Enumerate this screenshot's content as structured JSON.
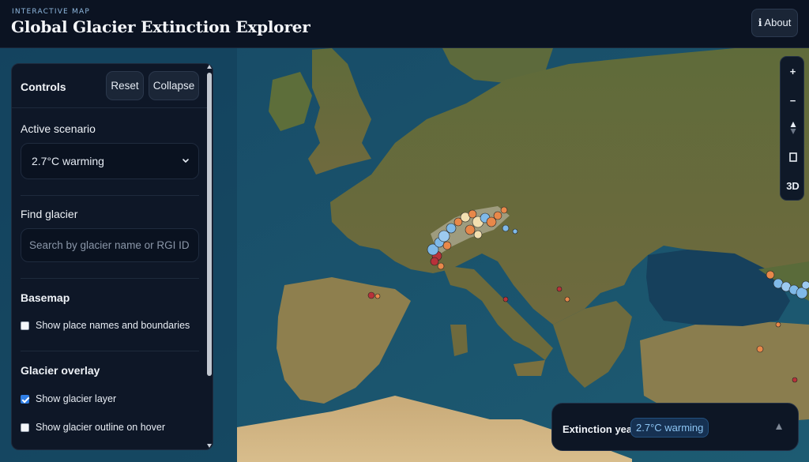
{
  "header": {
    "eyebrow": "INTERACTIVE MAP",
    "title": "Global Glacier Extinction Explorer",
    "about_icon": "info-icon",
    "about_label": "ℹ About"
  },
  "controls": {
    "title": "Controls",
    "reset_label": "Reset",
    "collapse_label": "Collapse",
    "scenario": {
      "label": "Active scenario",
      "selected": "2.7°C warming"
    },
    "find": {
      "label": "Find glacier",
      "placeholder": "Search by glacier name or RGI ID"
    },
    "basemap": {
      "label": "Basemap",
      "place_names_label": "Show place names and boundaries",
      "place_names_checked": false
    },
    "overlay": {
      "label": "Glacier overlay",
      "layer_label": "Show glacier layer",
      "layer_checked": true,
      "outline_label": "Show glacier outline on hover",
      "outline_checked": false
    }
  },
  "map_controls": {
    "zoom_in": "+",
    "zoom_out": "−",
    "compass_icon": "compass-icon",
    "fullscreen_icon": "square-icon",
    "mode_3d": "3D"
  },
  "legend": {
    "label": "Extinction year",
    "badge": "2.7°C warming",
    "toggle_icon": "chevron-up-icon"
  },
  "colors": {
    "accent_blue": "#2f7ee5",
    "badge_text": "#8cc4f2",
    "glacier_blue": "#7fb9e8",
    "glacier_orange": "#e8884a",
    "glacier_red": "#b8323a",
    "glacier_cream": "#f2dfb0"
  }
}
